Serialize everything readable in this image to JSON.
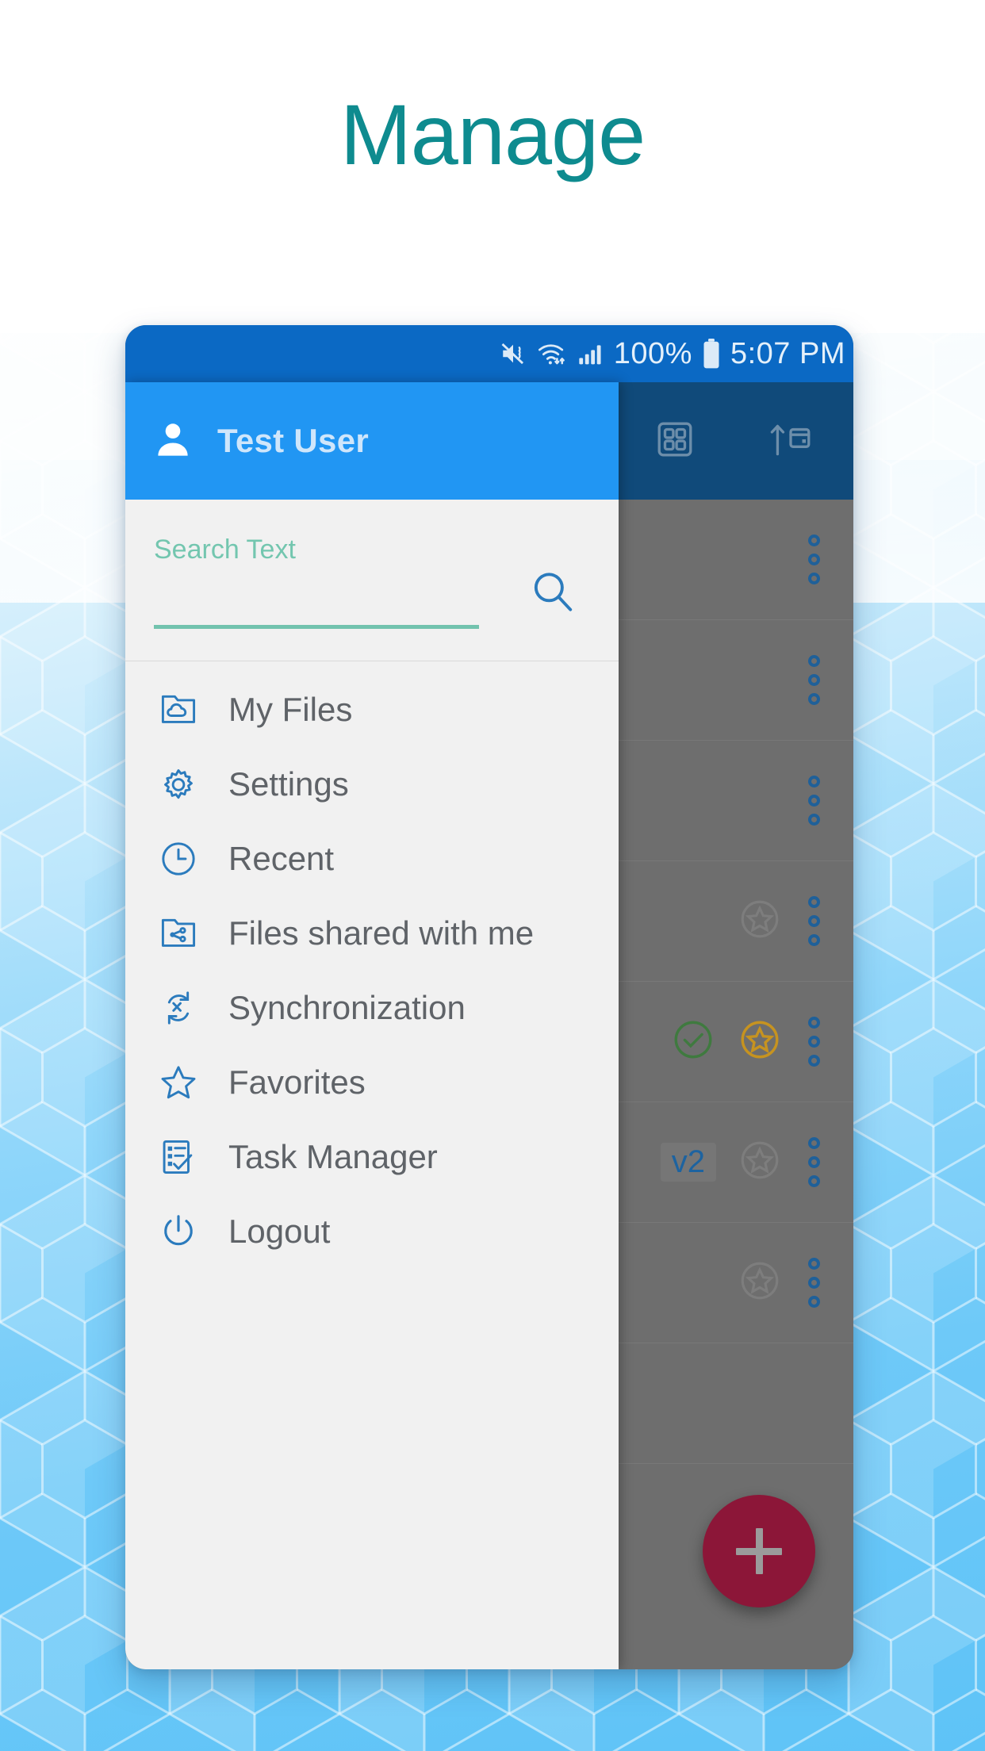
{
  "headline": "Manage",
  "theme": {
    "headline_color": "#0e8b8f",
    "statusbar_bg": "#0b69c4",
    "appbar_bg": "#2196f3",
    "appbar_dim_bg": "#104a7a",
    "drawer_bg": "#f1f1f1",
    "scrim_bg": "#6e6e6e",
    "accent_icon": "#2b7bbd",
    "search_accent": "#72c3ae",
    "fab_bg": "#8c1638",
    "check_green": "#3f7a3f",
    "star_orange": "#c69320",
    "badge_blue": "#1d63a0"
  },
  "statusbar": {
    "icons": [
      "mute-icon",
      "wifi-icon",
      "signal-icon"
    ],
    "battery_percent": "100%",
    "battery_icon": "battery-full-icon",
    "time": "5:07 PM"
  },
  "appbar": {
    "avatar_icon": "person-icon",
    "user_name": "Test User",
    "actions": [
      {
        "name": "refresh-icon"
      },
      {
        "name": "grid-view-icon"
      },
      {
        "name": "sort-by-date-icon"
      }
    ]
  },
  "search": {
    "label": "Search Text",
    "value": "",
    "placeholder": "Search Text",
    "button_icon": "search-icon"
  },
  "menu": {
    "items": [
      {
        "label": "My Files",
        "icon": "folder-cloud-icon"
      },
      {
        "label": "Settings",
        "icon": "gear-icon"
      },
      {
        "label": "Recent",
        "icon": "clock-icon"
      },
      {
        "label": "Files shared with me",
        "icon": "folder-share-icon"
      },
      {
        "label": "Synchronization",
        "icon": "sync-icon"
      },
      {
        "label": "Favorites",
        "icon": "star-icon"
      },
      {
        "label": "Task Manager",
        "icon": "checklist-icon"
      },
      {
        "label": "Logout",
        "icon": "power-icon"
      }
    ]
  },
  "file_list": {
    "rows": [
      {
        "badge": "",
        "status_icons": [],
        "overflow": "more-vert-icon"
      },
      {
        "badge": "",
        "status_icons": [],
        "overflow": "more-vert-icon"
      },
      {
        "badge": "",
        "status_icons": [],
        "overflow": "more-vert-icon"
      },
      {
        "badge": "",
        "status_icons": [
          "star-circle-icon"
        ],
        "overflow": "more-vert-icon"
      },
      {
        "badge": "",
        "status_icons": [
          "check-circle-icon",
          "star-circle-filled-icon"
        ],
        "overflow": "more-vert-icon"
      },
      {
        "badge": "v2",
        "status_icons": [
          "star-circle-icon"
        ],
        "overflow": "more-vert-icon"
      },
      {
        "badge": "",
        "status_icons": [
          "star-circle-icon"
        ],
        "overflow": "more-vert-icon"
      },
      {
        "badge": "",
        "status_icons": [],
        "overflow": "more-vert-icon"
      }
    ]
  },
  "fab": {
    "icon": "plus-icon",
    "label": "+"
  }
}
